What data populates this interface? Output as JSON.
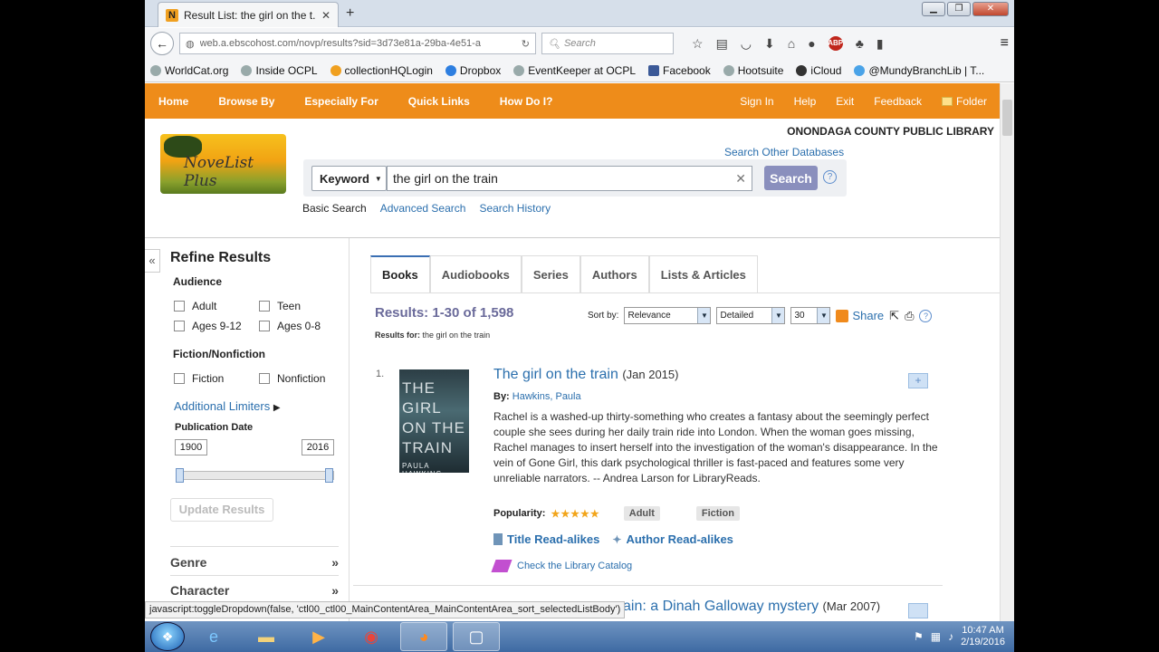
{
  "browser": {
    "tab_title": "Result List: the girl on the t...",
    "tab_favicon": "N",
    "url": "web.a.ebscohost.com/novp/results?sid=3d73e81a-29ba-4e51-a",
    "search_placeholder": "Search",
    "bookmarks": [
      "WorldCat.org",
      "Inside OCPL",
      "collectionHQLogin",
      "Dropbox",
      "EventKeeper at OCPL",
      "Facebook",
      "Hootsuite",
      "iCloud",
      "@MundyBranchLib | T..."
    ]
  },
  "topnav": {
    "left": [
      "Home",
      "Browse By",
      "Especially For",
      "Quick Links",
      "How Do I?"
    ],
    "right": [
      "Sign In",
      "Help",
      "Exit",
      "Feedback"
    ],
    "folder": "Folder"
  },
  "header": {
    "library_name": "ONONDAGA COUNTY PUBLIC LIBRARY",
    "logo_text": "NoveList Plus",
    "search_other": "Search Other Databases",
    "keyword_label": "Keyword",
    "query": "the girl on the train",
    "search_button": "Search",
    "help": "?",
    "links": [
      "Basic Search",
      "Advanced Search",
      "Search History"
    ]
  },
  "sidebar": {
    "collapse": "«",
    "title": "Refine Results",
    "audience_heading": "Audience",
    "audience": [
      "Adult",
      "Teen",
      "Ages 9-12",
      "Ages 0-8"
    ],
    "fiction_heading": "Fiction/Nonfiction",
    "fiction": [
      "Fiction",
      "Nonfiction"
    ],
    "additional_limiters": "Additional Limiters",
    "pub_date_label": "Publication Date",
    "year_from": "1900",
    "year_to": "2016",
    "update_button": "Update Results",
    "facets": [
      "Genre",
      "Character"
    ]
  },
  "results": {
    "tabs": [
      "Books",
      "Audiobooks",
      "Series",
      "Authors",
      "Lists & Articles"
    ],
    "count_text": "Results: 1-30 of 1,598",
    "results_for_label": "Results for:",
    "results_for_value": "the girl on the train",
    "sort_label": "Sort by:",
    "sort_value": "Relevance",
    "view_value": "Detailed",
    "per_page": "30",
    "share": "Share",
    "items": [
      {
        "index": "1.",
        "title": "The girl on the train",
        "date": "(Jan 2015)",
        "by_label": "By:",
        "author": "Hawkins, Paula",
        "cover_title": "THE GIRL ON THE TRAIN",
        "cover_author": "PAULA HAWKINS",
        "description": "Rachel is a washed-up thirty-something who creates a fantasy about the seemingly perfect couple she sees during her daily train ride into London. When the woman goes missing, Rachel manages to insert herself into the investigation of the woman's disappearance. In the vein of Gone Girl, this dark psychological thriller is fast-paced and features some very unreliable narrators. -- Andrea Larson for LibraryReads.",
        "popularity_label": "Popularity:",
        "popularity_stars": 5,
        "tags": [
          "Adult",
          "Fiction"
        ],
        "title_readalikes": "Title Read-alikes",
        "author_readalikes": "Author Read-alikes",
        "check_catalog": "Check the Library Catalog"
      },
      {
        "title_partial": "ain: a Dinah Galloway mystery",
        "date": "(Mar 2007)"
      }
    ]
  },
  "status_bar": "javascript:toggleDropdown(false, 'ctl00_ctl00_MainContentArea_MainContentArea_sort_selectedListBody')",
  "taskbar": {
    "time": "10:47 AM",
    "date": "2/19/2016"
  }
}
